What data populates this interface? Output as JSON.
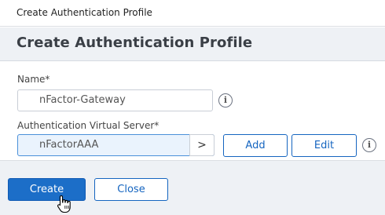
{
  "window": {
    "title": "Create Authentication Profile"
  },
  "header": {
    "title": "Create Authentication Profile"
  },
  "form": {
    "name_label": "Name*",
    "name_value": "nFactor-Gateway",
    "vserver_label": "Authentication Virtual Server*",
    "vserver_value": "nFactorAAA",
    "vserver_chevron": ">",
    "add_label": "Add",
    "edit_label": "Edit",
    "info_glyph": "i"
  },
  "footer": {
    "create_label": "Create",
    "close_label": "Close"
  },
  "colors": {
    "accent": "#1c6ec8",
    "header_bg": "#eef1f5",
    "active_field_bg": "#eaf3fd"
  },
  "icons": [
    "info-icon",
    "chevron-right-icon",
    "hand-pointer-cursor-icon"
  ]
}
